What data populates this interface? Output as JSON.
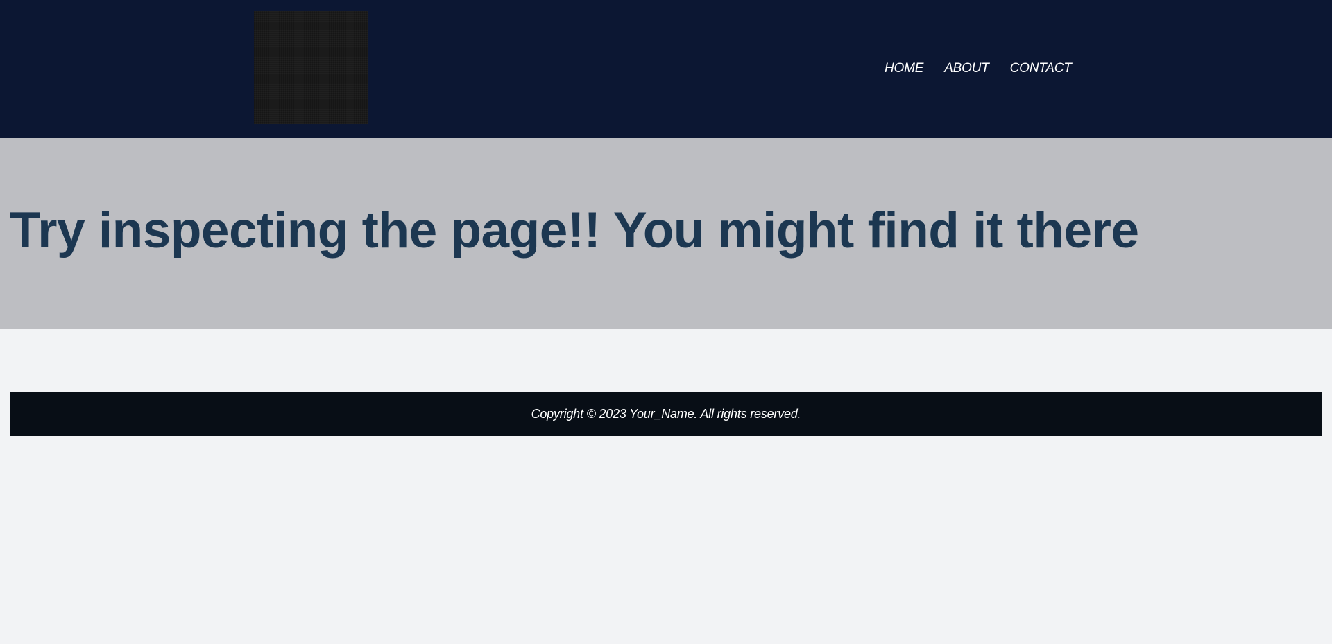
{
  "header": {
    "logo_name": "logo-image",
    "nav": {
      "home": "HOME",
      "about": "ABOUT",
      "contact": "CONTACT"
    },
    "background_color": "#0c1733"
  },
  "hero": {
    "heading": "Try inspecting the page!! You might find it there",
    "background_color": "#bdbec2",
    "text_color": "#1c3751"
  },
  "footer": {
    "copyright": "Copyright © 2023 Your_Name. All rights reserved.",
    "background_color": "#080e16"
  },
  "page": {
    "background_color": "#f2f3f5"
  }
}
